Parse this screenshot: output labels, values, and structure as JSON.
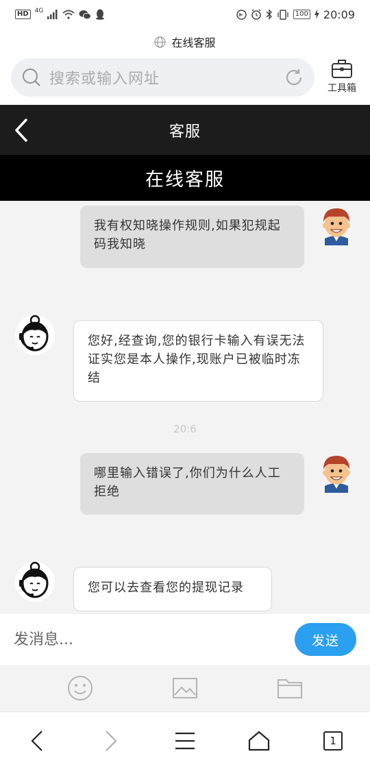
{
  "status_bar": {
    "hd": "HD",
    "network": "4G",
    "battery": "100",
    "time": "20:09"
  },
  "browser": {
    "page_title": "在线客服",
    "url_placeholder": "搜索或输入网址",
    "toolbox_label": "工具箱"
  },
  "app": {
    "header_title": "客服",
    "sub_title": "在线客服"
  },
  "messages": [
    {
      "from": "me",
      "text": "我有权知晓操作规则,如果犯规起码我知晓"
    },
    {
      "from": "agent",
      "text": "您好,经查询,您的银行卡输入有误无法证实您是本人操作,现账户已被临时冻结"
    },
    {
      "timestamp": "20:6"
    },
    {
      "from": "me",
      "text": "哪里输入错误了,你们为什么人工拒绝"
    },
    {
      "from": "agent",
      "text": "您可以去查看您的提现记录"
    }
  ],
  "composer": {
    "placeholder": "发消息...",
    "send_label": "发送"
  },
  "attach_icons": [
    "emoji-icon",
    "image-icon",
    "folder-icon"
  ],
  "nav": {
    "tab_count": "1"
  },
  "colors": {
    "header_bg": "#1c1c1c",
    "subheader_bg": "#000000",
    "send_button": "#2b9ff0",
    "chat_bg": "#f3f3f3"
  }
}
